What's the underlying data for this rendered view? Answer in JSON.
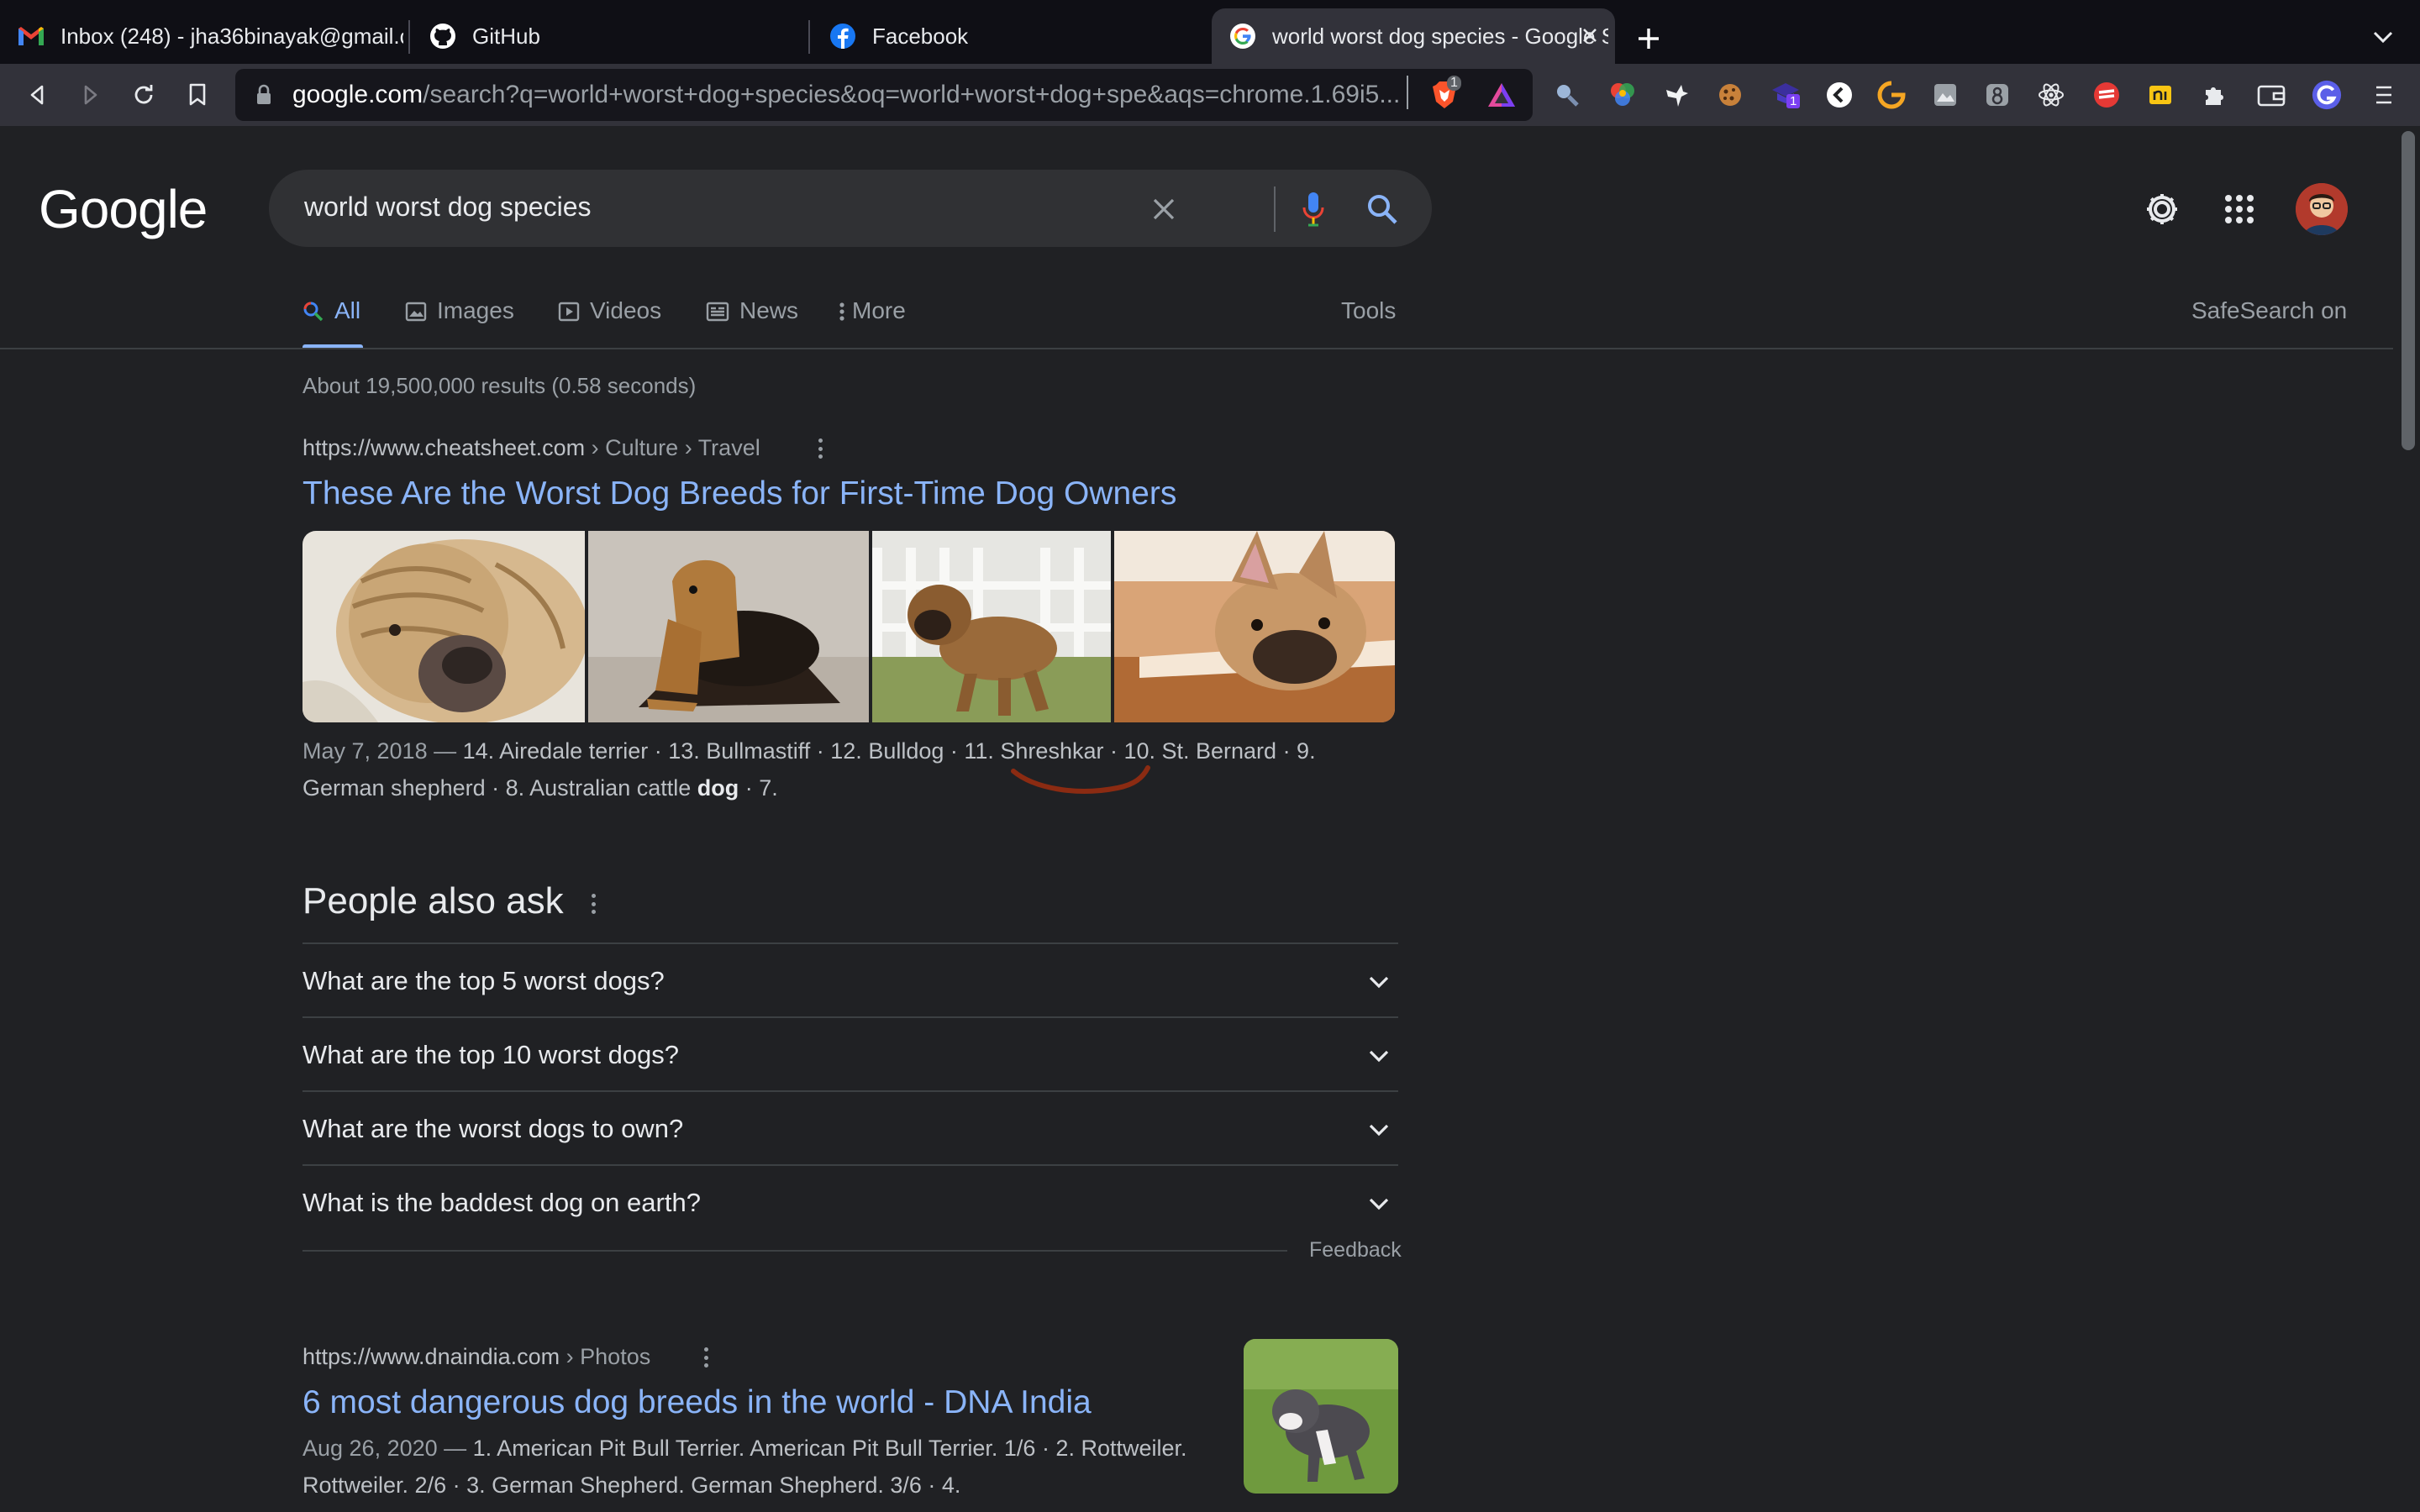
{
  "browser": {
    "tabs": [
      {
        "title": "Inbox (248) - jha36binayak@gmail.com",
        "icon": "gmail-icon"
      },
      {
        "title": "GitHub",
        "icon": "github-icon"
      },
      {
        "title": "Facebook",
        "icon": "facebook-icon"
      },
      {
        "title": "world worst dog species - Google Search",
        "icon": "google-icon",
        "active": true
      }
    ],
    "url_host": "google.com",
    "url_path": "/search?q=world+worst+dog+species&oq=world+worst+dog+spe&aqs=chrome.1.69i5...",
    "extension_badge": "1",
    "extension_badge_2": "1"
  },
  "search": {
    "query": "world worst dog species",
    "logo": "Google"
  },
  "tabs": {
    "all": "All",
    "images": "Images",
    "videos": "Videos",
    "news": "News",
    "more": "More",
    "tools": "Tools",
    "safesearch": "SafeSearch on"
  },
  "stats": "About 19,500,000 results (0.58 seconds)",
  "result1": {
    "cite": "https://www.cheatsheet.com",
    "breadcrumb": " › Culture › Travel",
    "title": "These Are the Worst Dog Breeds for First-Time Dog Owners",
    "date": "May 7, 2018 —",
    "snippet_a": " 14. Airedale terrier · 13. Bullmastiff · 12. Bulldog · 11. Shreshkar · 10. St. Bernard · 9. German shepherd · 8. Australian cattle ",
    "snippet_bold": "dog",
    "snippet_b": " · 7."
  },
  "paa": {
    "title": "People also ask",
    "questions": [
      "What are the top 5 worst dogs?",
      "What are the top 10 worst dogs?",
      "What are the worst dogs to own?",
      "What is the baddest dog on earth?"
    ],
    "feedback": "Feedback"
  },
  "result2": {
    "cite": "https://www.dnaindia.com",
    "breadcrumb": " › Photos",
    "title": "6 most dangerous dog breeds in the world - DNA India",
    "date": "Aug 26, 2020 —",
    "snippet": " 1. American Pit Bull Terrier. American Pit Bull Terrier. 1/6 · 2. Rottweiler. Rottweiler. 2/6 · 3. German Shepherd. German Shepherd. 3/6 · 4."
  },
  "colors": {
    "page_bg": "#202124",
    "link": "#8ab4f8",
    "text": "#bdc1c6",
    "annotation": "#8b2b12"
  }
}
